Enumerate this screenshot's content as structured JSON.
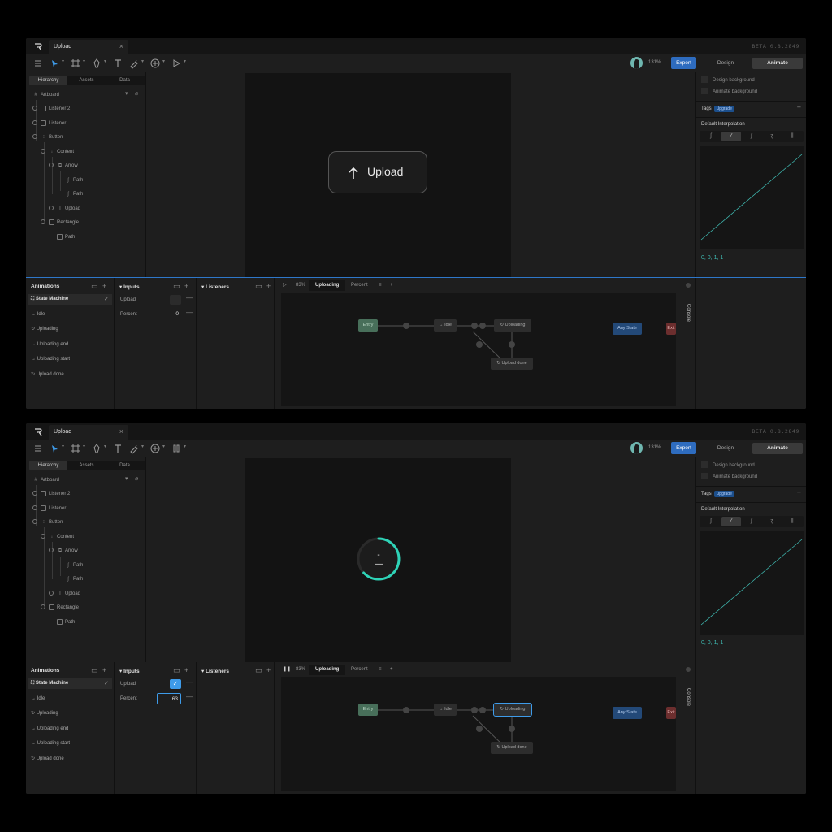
{
  "app": {
    "tab_title": "Upload",
    "version": "BETA 0.8.2849",
    "zoom": "131%",
    "export_label": "Export",
    "modes": [
      "Design",
      "Animate"
    ],
    "active_mode": "Animate"
  },
  "left_panel": {
    "tabs": [
      "Hierarchy",
      "Assets",
      "Data"
    ],
    "artboard": "Artboard",
    "tree": [
      {
        "label": "Listener 2",
        "depth": 1,
        "icon": "listener-icon"
      },
      {
        "label": "Listener",
        "depth": 1,
        "icon": "listener-icon"
      },
      {
        "label": "Button",
        "depth": 1,
        "icon": "group-icon"
      },
      {
        "label": "Content",
        "depth": 2,
        "icon": "group-icon"
      },
      {
        "label": "Arrow",
        "depth": 3,
        "icon": "shape-icon"
      },
      {
        "label": "Path",
        "depth": 4,
        "icon": "path-icon"
      },
      {
        "label": "Path",
        "depth": 4,
        "icon": "path-icon"
      },
      {
        "label": "Upload",
        "depth": 3,
        "icon": "text-icon"
      },
      {
        "label": "Rectangle",
        "depth": 2,
        "icon": "rectangle-icon"
      },
      {
        "label": "Path",
        "depth": 3,
        "icon": "path-icon"
      }
    ]
  },
  "canvas": {
    "button_label": "Upload",
    "progress_fraction": 0.63,
    "accent": "#2ed3b7"
  },
  "right_panel": {
    "design_background": "Design background",
    "animate_background": "Animate background",
    "tags_label": "Tags",
    "upgrade_label": "Upgrade",
    "interpolation_label": "Default Interpolation",
    "curve_values": "0, 0, 1, 1"
  },
  "bottom": {
    "animations_label": "Animations",
    "animations": [
      {
        "label": "State Machine",
        "icon": "state-machine-icon"
      },
      {
        "label": "Idle",
        "icon": "one-shot-icon"
      },
      {
        "label": "Uploading",
        "icon": "loop-icon"
      },
      {
        "label": "Uploading end",
        "icon": "one-shot-icon"
      },
      {
        "label": "Uploading start",
        "icon": "one-shot-icon"
      },
      {
        "label": "Upload done",
        "icon": "loop-icon"
      }
    ],
    "inputs_label": "Inputs",
    "inputs": {
      "upload_label": "Upload",
      "percent_label": "Percent",
      "percent_before": "0",
      "percent_after": "63"
    },
    "listeners_label": "Listeners",
    "graph_zoom": "83%",
    "graph_tabs": [
      "Uploading",
      "Percent"
    ],
    "console_label": "Console",
    "nodes": {
      "entry": "Entry",
      "idle": "Idle",
      "uploading": "Uploading",
      "upload_done": "Upload done",
      "any_state": "Any State",
      "exit": "Exit"
    }
  },
  "colors": {
    "export": "#2e6cbf",
    "checked": "#3e9be9",
    "progress": "#2ed3b7"
  }
}
